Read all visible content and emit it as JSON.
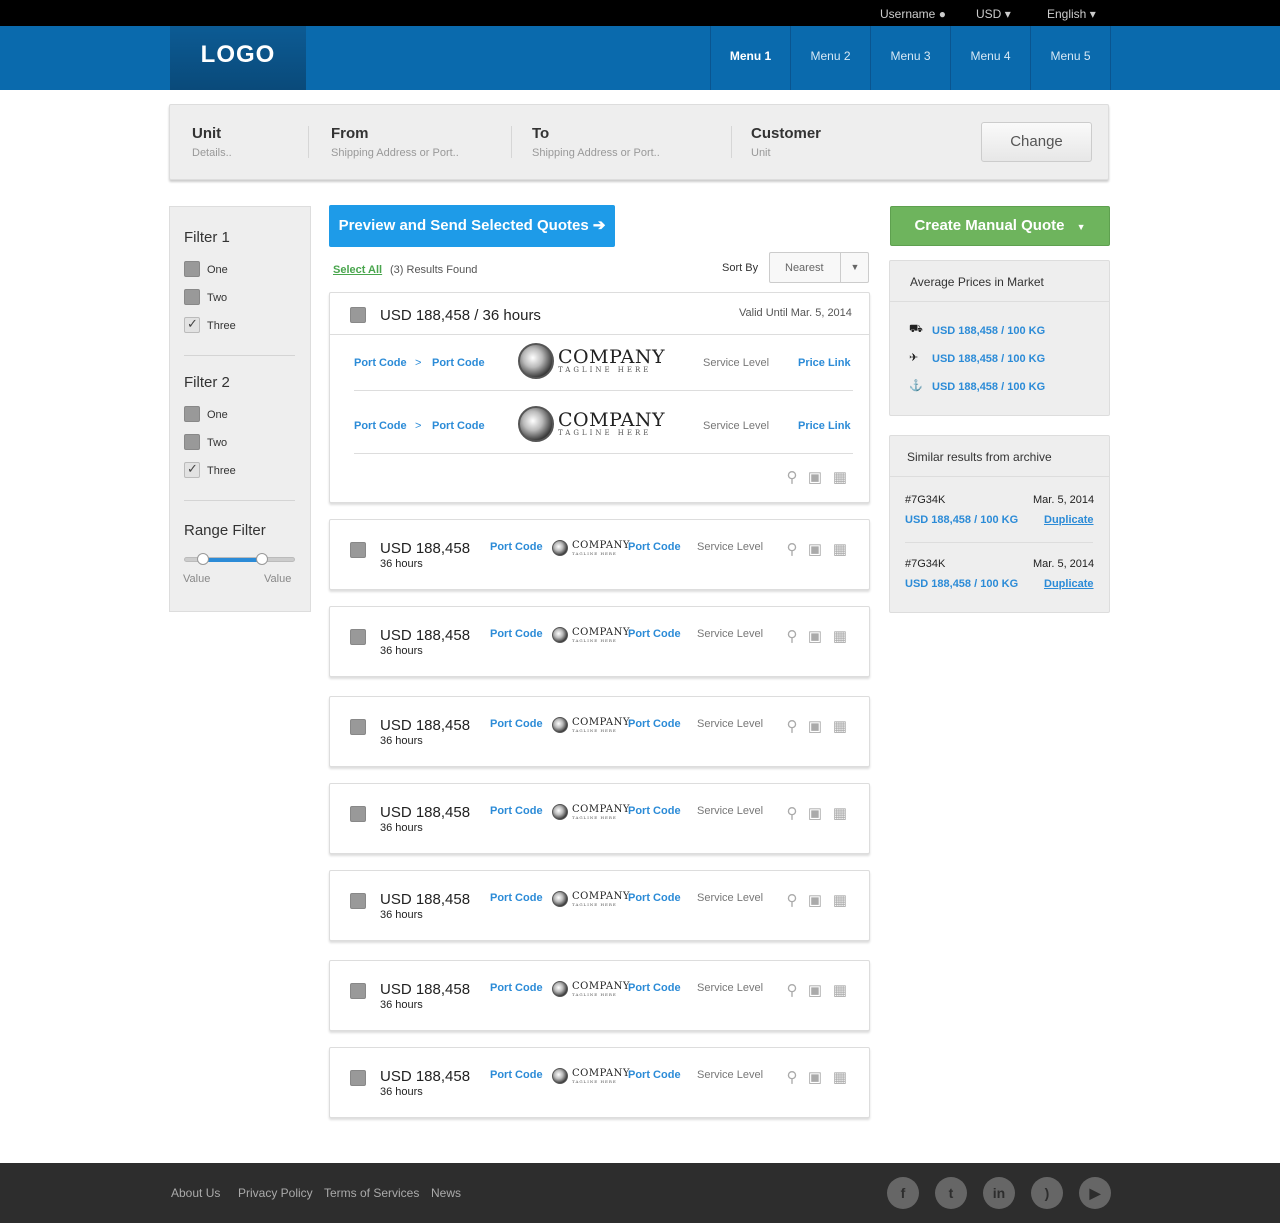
{
  "topbar": {
    "username": "Username",
    "currency": "USD",
    "language": "English"
  },
  "header": {
    "logo": "LOGO",
    "menu": [
      "Menu 1",
      "Menu 2",
      "Menu 3",
      "Menu 4",
      "Menu 5"
    ]
  },
  "search": {
    "fields": [
      {
        "title": "Unit",
        "sub": "Details.."
      },
      {
        "title": "From",
        "sub": "Shipping Address or Port.."
      },
      {
        "title": "To",
        "sub": "Shipping Address or Port.."
      },
      {
        "title": "Customer",
        "sub": "Unit"
      }
    ],
    "change_label": "Change"
  },
  "filters": {
    "filter1": {
      "title": "Filter 1",
      "options": [
        {
          "label": "One",
          "checked": false
        },
        {
          "label": "Two",
          "checked": false
        },
        {
          "label": "Three",
          "checked": true
        }
      ]
    },
    "filter2": {
      "title": "Filter 2",
      "options": [
        {
          "label": "One",
          "checked": false
        },
        {
          "label": "Two",
          "checked": false
        },
        {
          "label": "Three",
          "checked": true
        }
      ]
    },
    "range": {
      "title": "Range Filter",
      "min_label": "Value",
      "max_label": "Value"
    }
  },
  "toolbar": {
    "preview_label": "Preview and Send Selected Quotes ➔",
    "select_all": "Select All",
    "results": "(3) Results Found",
    "sort_by": "Sort By",
    "sort_value": "Nearest"
  },
  "expanded_quote": {
    "title": "USD 188,458 / 36 hours",
    "valid": "Valid Until Mar. 5, 2014",
    "legs": [
      {
        "from": "Port Code",
        "to": "Port Code",
        "service": "Service Level",
        "price_link": "Price Link"
      },
      {
        "from": "Port Code",
        "to": "Port Code",
        "service": "Service Level",
        "price_link": "Price Link"
      }
    ]
  },
  "company": {
    "name": "COMPANY",
    "tagline": "TAGLINE HERE"
  },
  "quotes": [
    {
      "price": "USD 188,458",
      "hours": "36 hours",
      "from": "Port Code",
      "to": "Port Code",
      "service": "Service Level"
    },
    {
      "price": "USD 188,458",
      "hours": "36 hours",
      "from": "Port Code",
      "to": "Port Code",
      "service": "Service Level"
    },
    {
      "price": "USD 188,458",
      "hours": "36 hours",
      "from": "Port Code",
      "to": "Port Code",
      "service": "Service Level"
    },
    {
      "price": "USD 188,458",
      "hours": "36 hours",
      "from": "Port Code",
      "to": "Port Code",
      "service": "Service Level"
    },
    {
      "price": "USD 188,458",
      "hours": "36 hours",
      "from": "Port Code",
      "to": "Port Code",
      "service": "Service Level"
    },
    {
      "price": "USD 188,458",
      "hours": "36 hours",
      "from": "Port Code",
      "to": "Port Code",
      "service": "Service Level"
    },
    {
      "price": "USD 188,458",
      "hours": "36 hours",
      "from": "Port Code",
      "to": "Port Code",
      "service": "Service Level"
    }
  ],
  "right": {
    "create_label": "Create Manual Quote",
    "avg_title": "Average Prices in Market",
    "avg_items": [
      {
        "icon": "truck-icon",
        "text": "USD 188,458 / 100 KG"
      },
      {
        "icon": "plane-icon",
        "text": "USD 188,458 / 100 KG"
      },
      {
        "icon": "ship-icon",
        "text": "USD 188,458 / 100 KG"
      }
    ],
    "archive_title": "Similar results from archive",
    "archive_items": [
      {
        "id": "#7G34K",
        "date": "Mar. 5, 2014",
        "price": "USD 188,458 / 100 KG",
        "action": "Duplicate"
      },
      {
        "id": "#7G34K",
        "date": "Mar. 5, 2014",
        "price": "USD 188,458 / 100 KG",
        "action": "Duplicate"
      }
    ]
  },
  "footer": {
    "links": [
      "About Us",
      "Privacy Policy",
      "Terms of Services",
      "News"
    ],
    "social": [
      {
        "icon": "facebook-icon",
        "glyph": "f"
      },
      {
        "icon": "twitter-icon",
        "glyph": "t"
      },
      {
        "icon": "linkedin-icon",
        "glyph": "in"
      },
      {
        "icon": "rss-icon",
        "glyph": ")"
      },
      {
        "icon": "youtube-icon",
        "glyph": "▶"
      }
    ]
  },
  "colors": {
    "brand_blue": "#0a6aad",
    "accent_blue": "#1e9be8",
    "accent_green": "#6eb45d",
    "footer": "#2d2d2d"
  }
}
